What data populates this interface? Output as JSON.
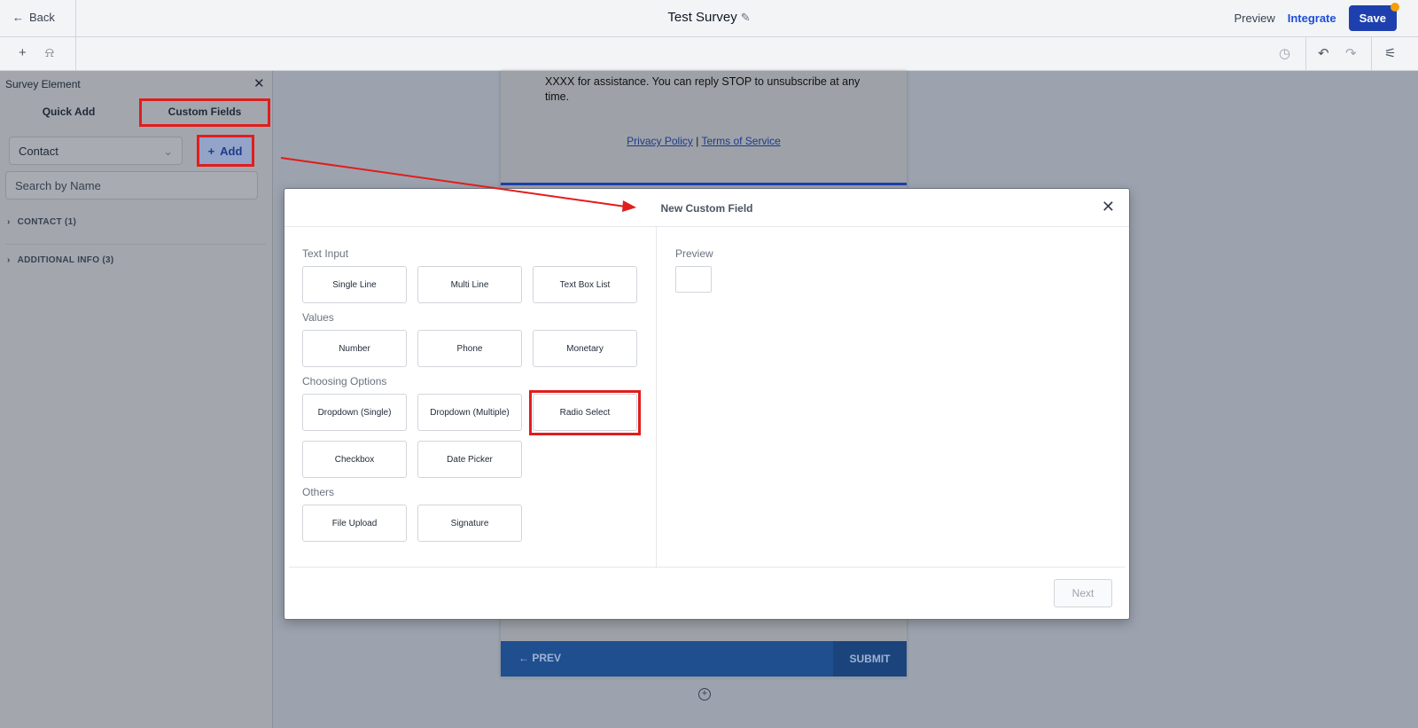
{
  "header": {
    "back_label": "Back",
    "title": "Test Survey",
    "preview_label": "Preview",
    "integrate_label": "Integrate",
    "save_label": "Save"
  },
  "sidebar": {
    "title": "Survey Element",
    "tabs": [
      {
        "label": "Quick Add",
        "active": false
      },
      {
        "label": "Custom Fields",
        "active": true
      }
    ],
    "object_select": "Contact",
    "add_button": "Add",
    "search_placeholder": "Search by Name",
    "groups": [
      {
        "label": "CONTACT (1)"
      },
      {
        "label": "ADDITIONAL INFO (3)"
      }
    ]
  },
  "canvas": {
    "body_text": "XXXX for assistance. You can reply STOP to unsubscribe at any time.",
    "privacy_link": "Privacy Policy",
    "link_separator": "|",
    "terms_link": "Terms of Service",
    "prev_label": "PREV",
    "submit_label": "SUBMIT"
  },
  "modal": {
    "title": "New Custom Field",
    "sections": [
      {
        "label": "Text Input",
        "options": [
          "Single Line",
          "Multi Line",
          "Text Box List"
        ]
      },
      {
        "label": "Values",
        "options": [
          "Number",
          "Phone",
          "Monetary"
        ]
      },
      {
        "label": "Choosing Options",
        "options": [
          "Dropdown (Single)",
          "Dropdown (Multiple)",
          "Radio Select",
          "Checkbox",
          "Date Picker"
        ]
      },
      {
        "label": "Others",
        "options": [
          "File Upload",
          "Signature"
        ]
      }
    ],
    "preview_label": "Preview",
    "next_label": "Next"
  },
  "annotations": {
    "highlight_color": "#e11d1d"
  },
  "icons": [
    "arrow-left-icon",
    "pencil-icon",
    "plus-icon",
    "bell-icon",
    "history-icon",
    "undo-icon",
    "redo-icon",
    "settings-sliders-icon",
    "close-icon",
    "chevron-down-icon",
    "chevron-right-icon",
    "plus-circle-icon"
  ]
}
